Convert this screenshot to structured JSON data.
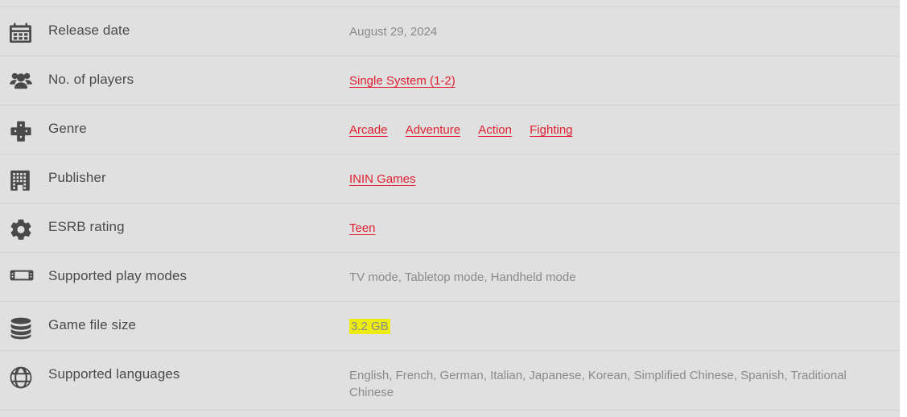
{
  "table": {
    "rows": [
      {
        "icon": "calendar-icon",
        "label": "Release date",
        "value_text": "August 29, 2024",
        "value_type": "text"
      },
      {
        "icon": "players-group-icon",
        "label": "No. of players",
        "value_type": "links",
        "links": [
          "Single System (1-2)"
        ]
      },
      {
        "icon": "dpad-icon",
        "label": "Genre",
        "value_type": "links",
        "links": [
          "Arcade",
          "Adventure",
          "Action",
          "Fighting"
        ]
      },
      {
        "icon": "building-icon",
        "label": "Publisher",
        "value_type": "links",
        "links": [
          "ININ Games"
        ]
      },
      {
        "icon": "gear-icon",
        "label": "ESRB rating",
        "value_type": "links",
        "links": [
          "Teen"
        ]
      },
      {
        "icon": "handheld-console-icon",
        "label": "Supported play modes",
        "value_text": "TV mode, Tabletop mode, Handheld mode",
        "value_type": "text"
      },
      {
        "icon": "database-icon",
        "label": "Game file size",
        "value_text": "3.2 GB",
        "value_type": "highlight"
      },
      {
        "icon": "globe-icon",
        "label": "Supported languages",
        "value_text": "English, French, German, Italian, Japanese, Korean, Simplified Chinese, Spanish, Traditional Chinese",
        "value_type": "text"
      }
    ]
  },
  "colors": {
    "background": "#e0e0e0",
    "divider": "#d2d2d2",
    "label_text": "#4a4a4a",
    "value_text": "#8a8a8a",
    "link_red": "#e02030",
    "highlight_yellow": "#ecec13",
    "icon": "#4a4a4a"
  }
}
